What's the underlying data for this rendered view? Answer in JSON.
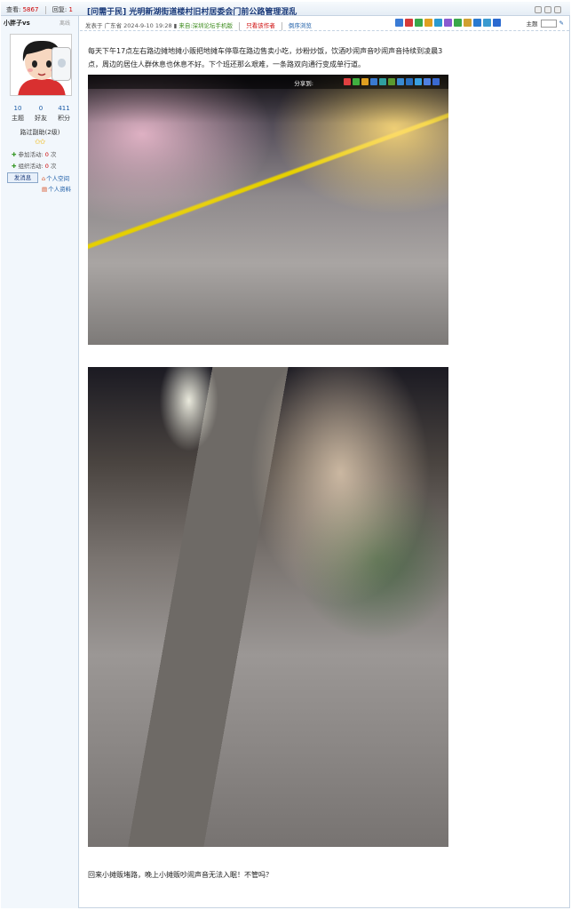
{
  "header": {
    "views_label": "查看:",
    "views": "5867",
    "replies_label": "回复:",
    "replies": "1",
    "title": "[问需于民] 光明新湖街道楼村旧村居委会门前公路管理混乱"
  },
  "author": {
    "name": "小胖子vs",
    "status": "离线",
    "stats": [
      {
        "num": "10",
        "label": "主题"
      },
      {
        "num": "0",
        "label": "好友"
      },
      {
        "num": "411",
        "label": "积分"
      }
    ],
    "rank": "路过副助(2级)",
    "stars": "✩✩",
    "activity_join": "参加活动:",
    "activity_join_count": "0",
    "activity_org": "组织活动:",
    "activity_org_count": "0",
    "times_unit": "次",
    "send_msg": "发消息",
    "space": "个人空间",
    "profile": "个人资料"
  },
  "post": {
    "posted_prefix": "发表于",
    "location": "广东省",
    "datetime": "2024-9-10 19:28",
    "from_label": "来自:",
    "from": "深圳论坛手机版",
    "only_author": "只看该作者",
    "reverse": "倒序浏览",
    "zoom_label": "主题",
    "share_label": "分享到:",
    "body": "每天下午17点左右路边摊地摊小贩把地摊车停靠在路边售卖小吃，炒粉炒饭，饮酒吵闹声音吵闹声音持续到凌晨3点，周边的居住人群休息也休息不好。下个班还那么艰难，一条路双向通行变成单行道。",
    "caption": "回来小摊贩堵路，晚上小摊贩吵闹声音无法入眠！不管吗？"
  },
  "colors": {
    "title_blue": "#1a3a7a",
    "sidebar_bg": "#f2f7fc",
    "border": "#c5d3e2",
    "star": "#f0b400"
  }
}
